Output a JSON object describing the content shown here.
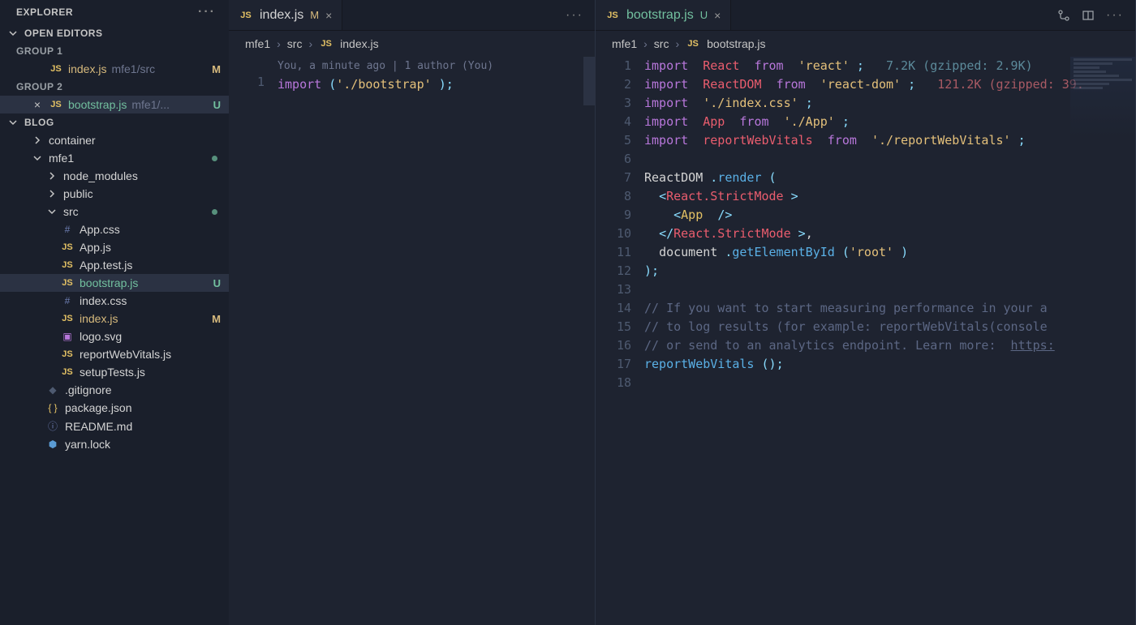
{
  "sidebar": {
    "title": "EXPLORER",
    "openEditors": "OPEN EDITORS",
    "groups": [
      {
        "label": "GROUP 1",
        "file": {
          "name": "index.js",
          "path": "mfe1/src",
          "status": "M"
        }
      },
      {
        "label": "GROUP 2",
        "file": {
          "name": "bootstrap.js",
          "path": "mfe1/...",
          "status": "U"
        }
      }
    ],
    "workspace": "BLOG",
    "tree": [
      {
        "type": "folder",
        "name": "container",
        "depth": 1,
        "expanded": false
      },
      {
        "type": "folder",
        "name": "mfe1",
        "depth": 1,
        "expanded": true,
        "mod": true
      },
      {
        "type": "folder",
        "name": "node_modules",
        "depth": 2,
        "expanded": false,
        "dim": true
      },
      {
        "type": "folder",
        "name": "public",
        "depth": 2,
        "expanded": false
      },
      {
        "type": "folder",
        "name": "src",
        "depth": 2,
        "expanded": true,
        "mod": true
      },
      {
        "type": "file",
        "name": "App.css",
        "depth": 3,
        "icon": "css"
      },
      {
        "type": "file",
        "name": "App.js",
        "depth": 3,
        "icon": "js"
      },
      {
        "type": "file",
        "name": "App.test.js",
        "depth": 3,
        "icon": "js"
      },
      {
        "type": "file",
        "name": "bootstrap.js",
        "depth": 3,
        "icon": "js",
        "status": "U",
        "active": true
      },
      {
        "type": "file",
        "name": "index.css",
        "depth": 3,
        "icon": "css"
      },
      {
        "type": "file",
        "name": "index.js",
        "depth": 3,
        "icon": "js",
        "status": "M"
      },
      {
        "type": "file",
        "name": "logo.svg",
        "depth": 3,
        "icon": "svg"
      },
      {
        "type": "file",
        "name": "reportWebVitals.js",
        "depth": 3,
        "icon": "js"
      },
      {
        "type": "file",
        "name": "setupTests.js",
        "depth": 3,
        "icon": "js"
      },
      {
        "type": "file",
        "name": ".gitignore",
        "depth": 2,
        "icon": "gitig"
      },
      {
        "type": "file",
        "name": "package.json",
        "depth": 2,
        "icon": "json"
      },
      {
        "type": "file",
        "name": "README.md",
        "depth": 2,
        "icon": "md"
      },
      {
        "type": "file",
        "name": "yarn.lock",
        "depth": 2,
        "icon": "yarn"
      }
    ]
  },
  "editors": [
    {
      "tab": {
        "name": "index.js",
        "status": "M"
      },
      "breadcrumb": [
        "mfe1",
        "src",
        "index.js"
      ],
      "annotation": "You, a minute ago | 1 author (You)",
      "code": [
        {
          "n": 1,
          "tokens": [
            [
              "c-kw",
              "import"
            ],
            [
              "c-punc",
              "("
            ],
            [
              "c-str",
              "'./bootstrap'"
            ],
            [
              "c-punc",
              ")"
            ],
            [
              "c-punc",
              ";"
            ]
          ]
        }
      ]
    },
    {
      "tab": {
        "name": "bootstrap.js",
        "status": "U"
      },
      "breadcrumb": [
        "mfe1",
        "src",
        "bootstrap.js"
      ],
      "code": [
        {
          "n": 1,
          "tokens": [
            [
              "c-kw",
              "import"
            ],
            [
              "",
              ""
            ],
            [
              "c-def",
              "React"
            ],
            [
              "",
              ""
            ],
            [
              "c-kw",
              "from"
            ],
            [
              "",
              ""
            ],
            [
              "c-str",
              "'react'"
            ],
            [
              "c-punc",
              ";"
            ],
            [
              "",
              "   "
            ],
            [
              "c-size",
              "7.2K (gzipped: 2.9K)"
            ]
          ]
        },
        {
          "n": 2,
          "tokens": [
            [
              "c-kw",
              "import"
            ],
            [
              "",
              ""
            ],
            [
              "c-def",
              "ReactDOM"
            ],
            [
              "",
              ""
            ],
            [
              "c-kw",
              "from"
            ],
            [
              "",
              ""
            ],
            [
              "c-str",
              "'react-dom'"
            ],
            [
              "c-punc",
              ";"
            ],
            [
              "",
              "   "
            ],
            [
              "c-size2",
              "121.2K (gzipped: 39."
            ]
          ]
        },
        {
          "n": 3,
          "tokens": [
            [
              "c-kw",
              "import"
            ],
            [
              "",
              ""
            ],
            [
              "c-str",
              "'./index.css'"
            ],
            [
              "c-punc",
              ";"
            ]
          ]
        },
        {
          "n": 4,
          "tokens": [
            [
              "c-kw",
              "import"
            ],
            [
              "",
              ""
            ],
            [
              "c-def",
              "App"
            ],
            [
              "",
              ""
            ],
            [
              "c-kw",
              "from"
            ],
            [
              "",
              ""
            ],
            [
              "c-str",
              "'./App'"
            ],
            [
              "c-punc",
              ";"
            ]
          ]
        },
        {
          "n": 5,
          "tokens": [
            [
              "c-kw",
              "import"
            ],
            [
              "",
              ""
            ],
            [
              "c-def",
              "reportWebVitals"
            ],
            [
              "",
              ""
            ],
            [
              "c-kw",
              "from"
            ],
            [
              "",
              ""
            ],
            [
              "c-str",
              "'./reportWebVitals'"
            ],
            [
              "c-punc",
              ";"
            ]
          ]
        },
        {
          "n": 6,
          "tokens": []
        },
        {
          "n": 7,
          "tokens": [
            [
              "c-var",
              "ReactDOM"
            ],
            [
              "c-punc",
              "."
            ],
            [
              "c-fn",
              "render"
            ],
            [
              "c-punc",
              "("
            ]
          ]
        },
        {
          "n": 8,
          "tokens": [
            [
              "",
              "  "
            ],
            [
              "c-punc",
              "<"
            ],
            [
              "c-tag",
              "React.StrictMode"
            ],
            [
              "c-punc",
              ">"
            ]
          ]
        },
        {
          "n": 9,
          "tokens": [
            [
              "",
              "    "
            ],
            [
              "c-punc",
              "<"
            ],
            [
              "c-method",
              "App"
            ],
            [
              "",
              ""
            ],
            [
              "c-punc",
              "/>"
            ]
          ]
        },
        {
          "n": 10,
          "tokens": [
            [
              "",
              "  "
            ],
            [
              "c-punc",
              "</"
            ],
            [
              "c-tag",
              "React.StrictMode"
            ],
            [
              "c-punc",
              ">"
            ],
            [
              "c-var",
              ","
            ]
          ]
        },
        {
          "n": 11,
          "tokens": [
            [
              "",
              "  "
            ],
            [
              "c-var",
              "document"
            ],
            [
              "c-punc",
              "."
            ],
            [
              "c-fn",
              "getElementById"
            ],
            [
              "c-punc",
              "("
            ],
            [
              "c-str",
              "'root'"
            ],
            [
              "c-punc",
              ")"
            ]
          ]
        },
        {
          "n": 12,
          "tokens": [
            [
              "c-punc",
              ")"
            ],
            [
              "c-punc",
              ";"
            ]
          ]
        },
        {
          "n": 13,
          "tokens": []
        },
        {
          "n": 14,
          "tokens": [
            [
              "c-comment",
              "// If you want to start measuring performance in your a"
            ]
          ]
        },
        {
          "n": 15,
          "tokens": [
            [
              "c-comment",
              "// to log results (for example: reportWebVitals(console"
            ]
          ]
        },
        {
          "n": 16,
          "tokens": [
            [
              "c-comment",
              "// or send to an analytics endpoint. Learn more: "
            ],
            [
              "c-link",
              "https:"
            ]
          ]
        },
        {
          "n": 17,
          "tokens": [
            [
              "c-fn",
              "reportWebVitals"
            ],
            [
              "c-punc",
              "("
            ],
            [
              "c-punc",
              ")"
            ],
            [
              "c-punc",
              ";"
            ]
          ]
        },
        {
          "n": 18,
          "tokens": []
        }
      ]
    }
  ]
}
